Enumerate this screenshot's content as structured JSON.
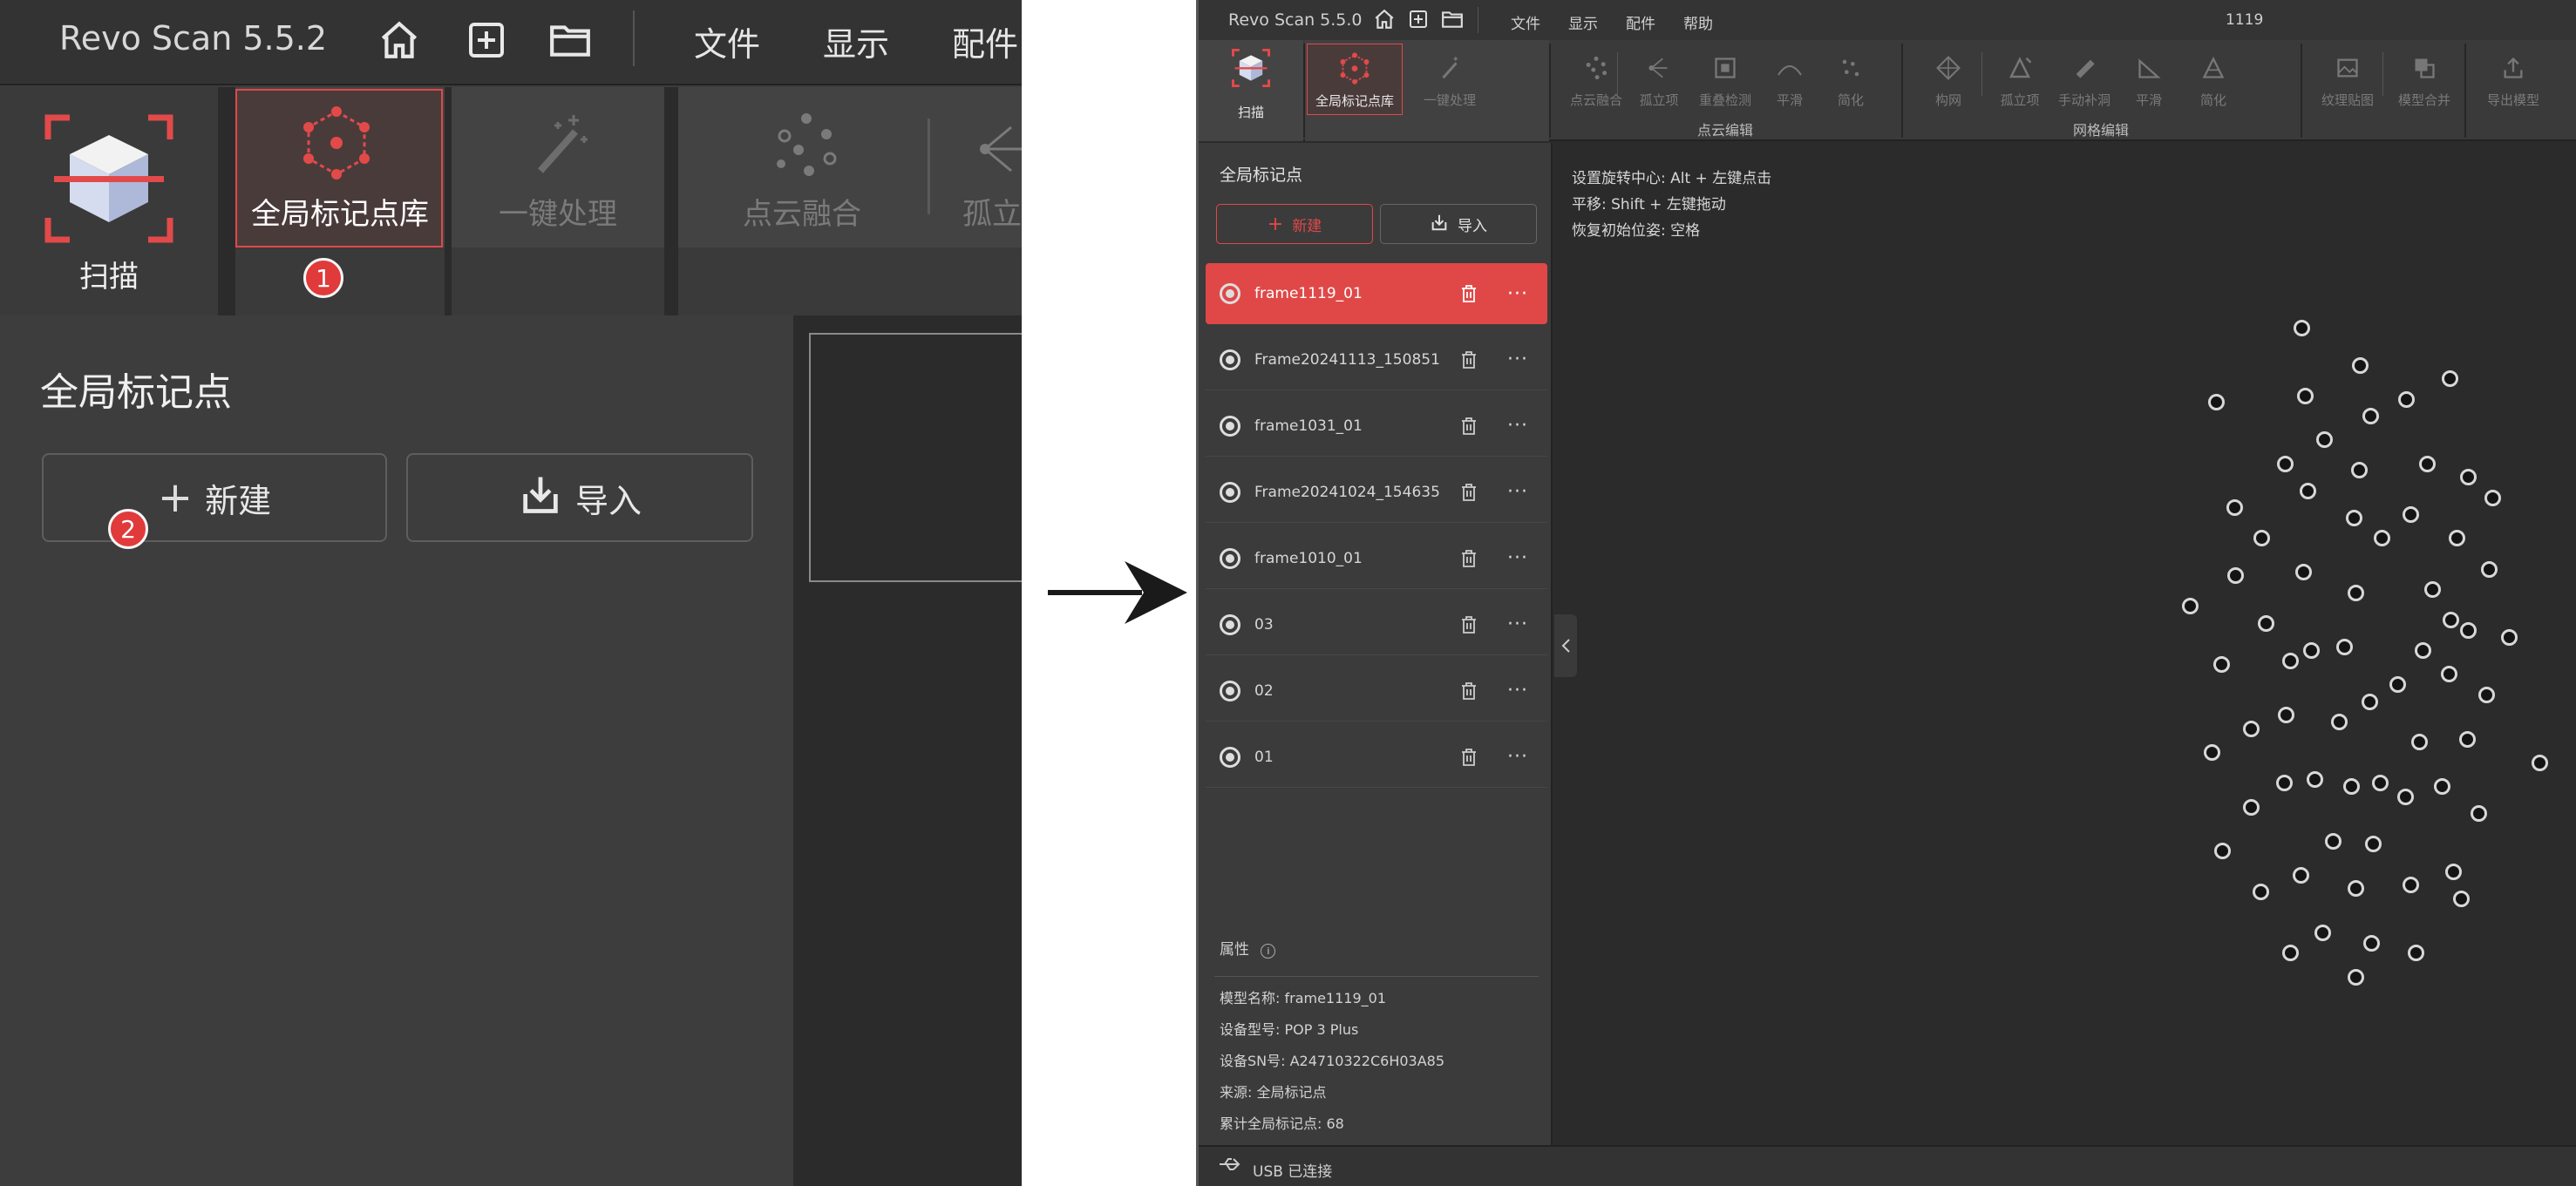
{
  "zoomed": {
    "app_title": "Revo Scan 5.5.2",
    "menu": [
      "文件",
      "显示",
      "配件"
    ],
    "ribbon": {
      "scan_label": "扫描",
      "global_marker_lib_label": "全局标记点库",
      "one_click_label": "一键处理",
      "point_cloud_fusion_label": "点云融合",
      "isolated_label": "孤立"
    },
    "badge_1": "1",
    "badge_2": "2",
    "panel_title": "全局标记点",
    "new_label": "新建",
    "import_label": "导入"
  },
  "app": {
    "title": "Revo Scan 5.5.0",
    "menu": [
      "文件",
      "显示",
      "配件",
      "帮助"
    ],
    "frame_counter": "1119",
    "tools": [
      {
        "label": "扫描"
      },
      {
        "label": "全局标记点库"
      },
      {
        "label": "一键处理"
      },
      {
        "label": "点云融合"
      },
      {
        "label": "孤立项"
      },
      {
        "label": "重叠检测"
      },
      {
        "label": "平滑"
      },
      {
        "label": "简化"
      },
      {
        "label": "构网"
      },
      {
        "label": "孤立项"
      },
      {
        "label": "手动补洞"
      },
      {
        "label": "平滑"
      },
      {
        "label": "简化"
      },
      {
        "label": "纹理贴图"
      },
      {
        "label": "模型合并"
      },
      {
        "label": "导出模型"
      }
    ],
    "group_labels": {
      "point_cloud_edit": "点云编辑",
      "mesh_edit": "网格编辑"
    },
    "panel_title": "全局标记点",
    "new_label": "新建",
    "import_label": "导入",
    "marker_sets": [
      {
        "name": "frame1119_01",
        "selected": true
      },
      {
        "name": "Frame20241113_150851",
        "selected": false
      },
      {
        "name": "frame1031_01",
        "selected": false
      },
      {
        "name": "Frame20241024_154635",
        "selected": false
      },
      {
        "name": "frame1010_01",
        "selected": false
      },
      {
        "name": "03",
        "selected": false
      },
      {
        "name": "02",
        "selected": false
      },
      {
        "name": "01",
        "selected": false
      }
    ],
    "more_glyph": "···",
    "properties_title": "属性",
    "properties": [
      "模型名称:  frame1119_01",
      "设备型号:  POP 3 Plus",
      "设备SN号:  A24710322C6H03A85",
      "来源:  全局标记点",
      "累计全局标记点:  68"
    ],
    "hints": [
      "设置旋转中心: Alt + 左键点击",
      "平移: Shift + 左键拖动",
      "恢复初始位姿: 空格"
    ],
    "status": "USB 已连接",
    "colors": {
      "accent": "#e04848",
      "background": "#2b2b2b",
      "panel": "#3b3b3b"
    }
  }
}
